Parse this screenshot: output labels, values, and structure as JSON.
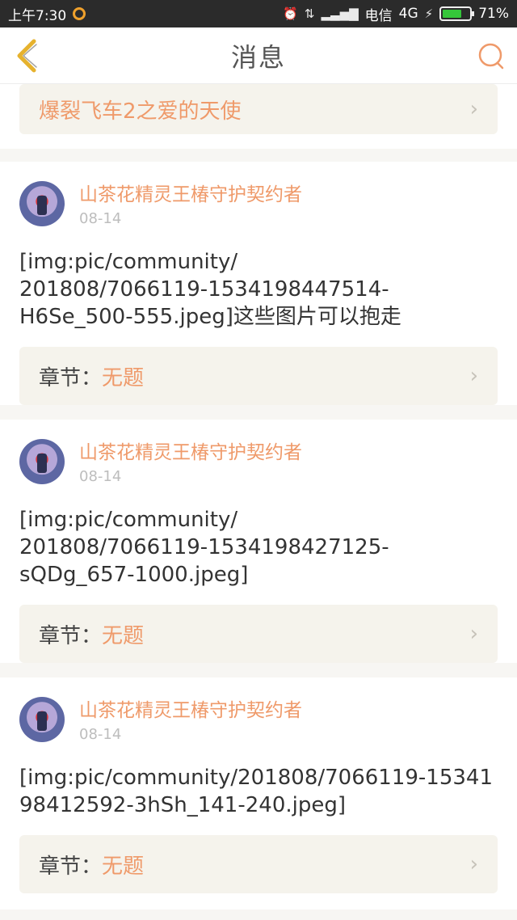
{
  "status_bar": {
    "time": "上午7:30",
    "carrier": "电信",
    "network": "4G",
    "battery": "71%",
    "battery_level": 0.71
  },
  "header": {
    "title": "消息",
    "back_icon": "chevron-left-icon",
    "search_icon": "search-icon"
  },
  "top_card": {
    "title": "爆裂飞车2之爱的天使"
  },
  "messages": [
    {
      "author": "山茶花精灵王椿守护契约者",
      "date": "08-14",
      "text": "[img:pic/community/\n201808/7066119-1534198447514-\nH6Se_500-555.jpeg]这些图片可以抱走",
      "chapter_label": "章节：",
      "chapter_value": "无题"
    },
    {
      "author": "山茶花精灵王椿守护契约者",
      "date": "08-14",
      "text": "[img:pic/community/\n201808/7066119-1534198427125-\nsQDg_657-1000.jpeg]",
      "chapter_label": "章节：",
      "chapter_value": "无题"
    },
    {
      "author": "山茶花精灵王椿守护契约者",
      "date": "08-14",
      "text": "[img:pic/community/201808/7066119-15341\n98412592-3hSh_141-240.jpeg]",
      "chapter_label": "章节：",
      "chapter_value": "无题"
    }
  ],
  "colors": {
    "accent": "#ef9a6a",
    "back": "#e6b22e"
  }
}
